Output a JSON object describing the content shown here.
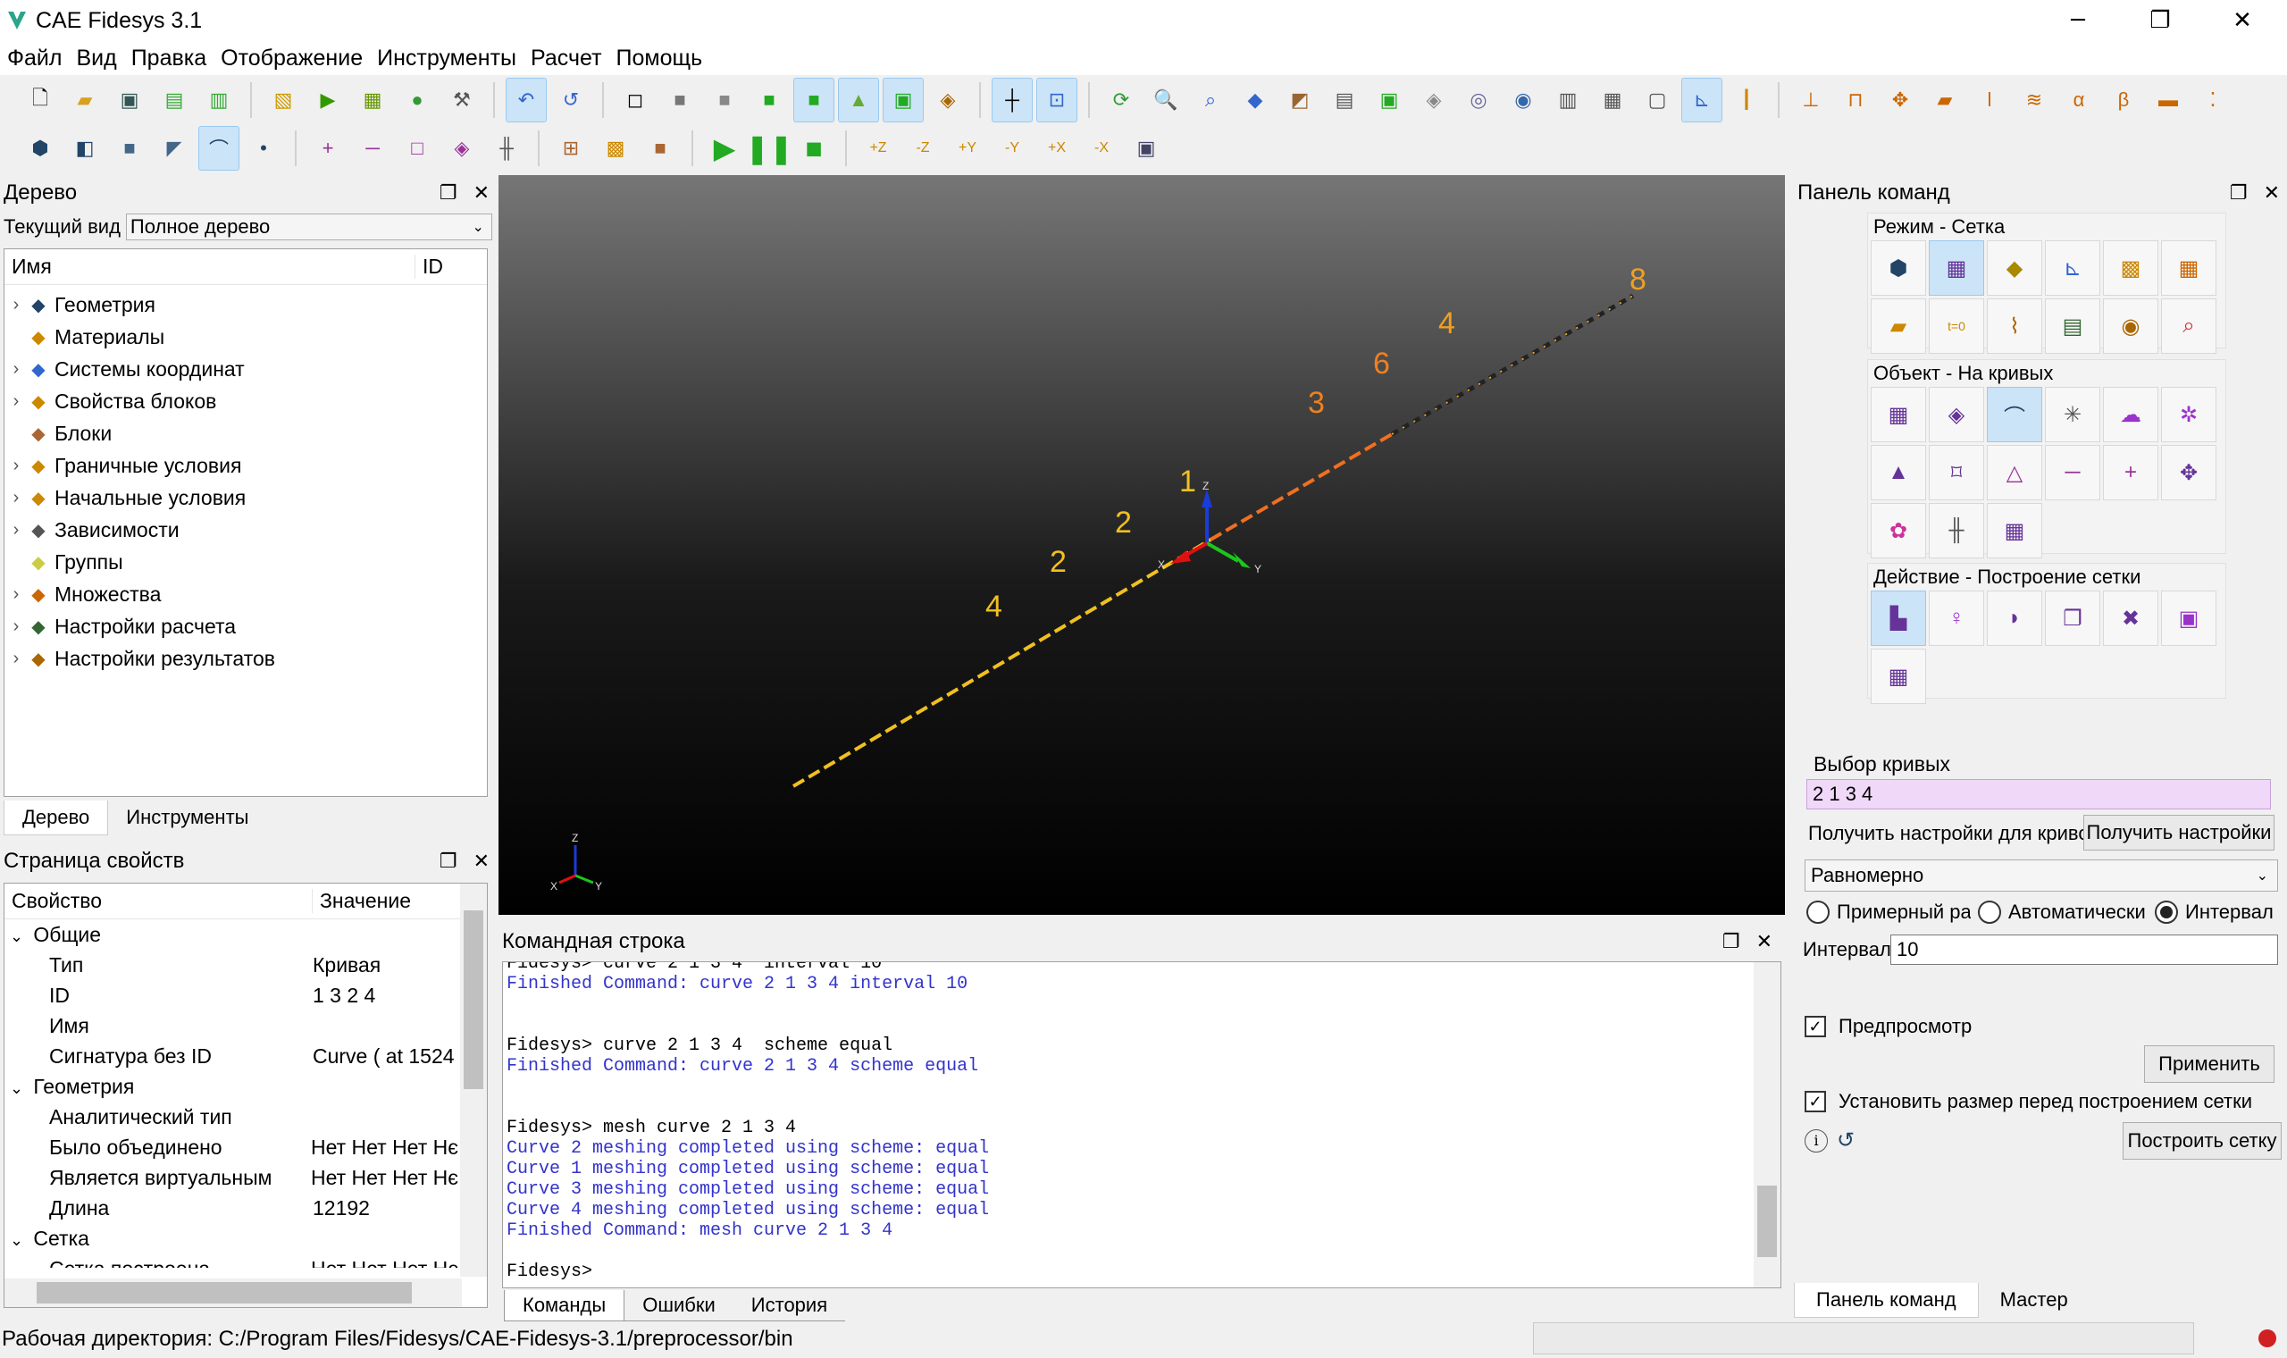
{
  "window": {
    "title": "CAE Fidesys 3.1",
    "minimize": "─",
    "restore": "❐",
    "close": "✕"
  },
  "menu": [
    "Файл",
    "Вид",
    "Правка",
    "Отображение",
    "Инструменты",
    "Расчет",
    "Помощь"
  ],
  "tree_panel": {
    "title": "Дерево",
    "view_label": "Текущий вид",
    "view_value": "Полное дерево",
    "col_name": "Имя",
    "col_id": "ID",
    "items": [
      {
        "label": "Геометрия",
        "icon": "geometry-icon",
        "expandable": true
      },
      {
        "label": "Материалы",
        "icon": "materials-icon",
        "expandable": false
      },
      {
        "label": "Системы координат",
        "icon": "coordinate-system-icon",
        "expandable": true
      },
      {
        "label": "Свойства блоков",
        "icon": "block-properties-icon",
        "expandable": true
      },
      {
        "label": "Блоки",
        "icon": "blocks-icon",
        "expandable": false
      },
      {
        "label": "Граничные условия",
        "icon": "boundary-conditions-icon",
        "expandable": true
      },
      {
        "label": "Начальные условия",
        "icon": "initial-conditions-icon",
        "expandable": true
      },
      {
        "label": "Зависимости",
        "icon": "dependencies-icon",
        "expandable": true
      },
      {
        "label": "Группы",
        "icon": "groups-icon",
        "expandable": false
      },
      {
        "label": "Множества",
        "icon": "sets-icon",
        "expandable": true
      },
      {
        "label": "Настройки расчета",
        "icon": "calc-settings-icon",
        "expandable": true
      },
      {
        "label": "Настройки результатов",
        "icon": "results-settings-icon",
        "expandable": true
      }
    ],
    "tabs": [
      "Дерево",
      "Инструменты"
    ]
  },
  "props_panel": {
    "title": "Страница свойств",
    "col_prop": "Свойство",
    "col_val": "Значение",
    "rows": [
      {
        "group": true,
        "key": "Общие",
        "value": ""
      },
      {
        "group": false,
        "key": "Тип",
        "value": "Кривая"
      },
      {
        "group": false,
        "key": "ID",
        "value": "1 3 2 4"
      },
      {
        "group": false,
        "key": "Имя",
        "value": ""
      },
      {
        "group": false,
        "key": "Сигнатура без ID",
        "value": "Curve ( at 1524"
      },
      {
        "group": true,
        "key": "Геометрия",
        "value": ""
      },
      {
        "group": false,
        "key": "Аналитический тип",
        "value": ""
      },
      {
        "group": false,
        "key": "Было объединено",
        "value": "Нет Нет Нет Нє"
      },
      {
        "group": false,
        "key": "Является виртуальным",
        "value": "Нет Нет Нет Нє"
      },
      {
        "group": false,
        "key": "Длина",
        "value": "12192"
      },
      {
        "group": true,
        "key": "Сетка",
        "value": ""
      },
      {
        "group": false,
        "key": "Сетка построена",
        "value": "Нет Нет Нет Нє"
      }
    ]
  },
  "viewport": {
    "labels": [
      {
        "text": "8",
        "color": "#f0a020"
      },
      {
        "text": "4",
        "color": "#f0a020"
      },
      {
        "text": "6",
        "color": "#f08020"
      },
      {
        "text": "3",
        "color": "#f08020"
      },
      {
        "text": "1",
        "color": "#f0c020"
      },
      {
        "text": "2",
        "color": "#f0c020"
      },
      {
        "text": "2",
        "color": "#f0c020"
      },
      {
        "text": "4",
        "color": "#f0c020"
      }
    ],
    "axis_x": "X",
    "axis_y": "Y",
    "axis_z": "Z"
  },
  "console": {
    "title": "Командная строка",
    "lines": [
      {
        "text": "Fidesys> curve 2 1 3 4  interval 10",
        "cls": ""
      },
      {
        "text": "Finished Command: curve 2 1 3 4 interval 10",
        "cls": "blue"
      },
      {
        "text": "",
        "cls": ""
      },
      {
        "text": "",
        "cls": ""
      },
      {
        "text": "Fidesys> curve 2 1 3 4  scheme equal",
        "cls": ""
      },
      {
        "text": "Finished Command: curve 2 1 3 4 scheme equal",
        "cls": "blue"
      },
      {
        "text": "",
        "cls": ""
      },
      {
        "text": "",
        "cls": ""
      },
      {
        "text": "Fidesys> mesh curve 2 1 3 4",
        "cls": ""
      },
      {
        "text": "Curve 2 meshing completed using scheme: equal",
        "cls": "blue"
      },
      {
        "text": "Curve 1 meshing completed using scheme: equal",
        "cls": "blue"
      },
      {
        "text": "Curve 3 meshing completed using scheme: equal",
        "cls": "blue"
      },
      {
        "text": "Curve 4 meshing completed using scheme: equal",
        "cls": "blue"
      },
      {
        "text": "Finished Command: mesh curve 2 1 3 4",
        "cls": "blue"
      },
      {
        "text": "",
        "cls": ""
      },
      {
        "text": "Fidesys>",
        "cls": ""
      }
    ],
    "tabs": [
      "Команды",
      "Ошибки",
      "История"
    ]
  },
  "command_panel": {
    "title": "Панель команд",
    "mode_title": "Режим - Сетка",
    "object_title": "Объект - На кривых",
    "action_title": "Действие - Построение сетки",
    "select_label": "Выбор кривых",
    "select_value": "2 1 3 4",
    "get_settings_label": "Получить настройки для криво",
    "get_settings_button": "Получить настройки",
    "scheme_value": "Равномерно",
    "radio_approx": "Примерный ра:",
    "radio_auto": "Автоматически",
    "radio_interval": "Интервал",
    "interval_label": "Интервал",
    "interval_value": "10",
    "preview_label": "Предпросмотр",
    "apply_button": "Применить",
    "set_size_label": "Установить размер перед построением сетки",
    "build_button": "Построить сетку",
    "tabs": [
      "Панель команд",
      "Мастер"
    ]
  },
  "status": {
    "text": "Рабочая директория: C:/Program Files/Fidesys/CAE-Fidesys-3.1/preprocessor/bin"
  }
}
